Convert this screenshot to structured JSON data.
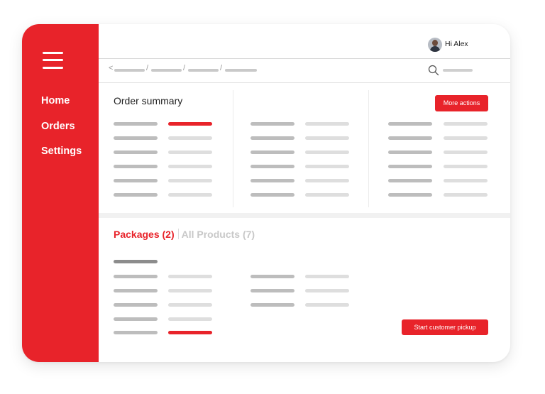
{
  "sidebar": {
    "items": [
      {
        "label": "Home"
      },
      {
        "label": "Orders"
      },
      {
        "label": "Settings"
      }
    ]
  },
  "header": {
    "greeting": "Hi Alex"
  },
  "breadcrumb": {
    "separators": [
      "<",
      "/",
      "/",
      "/"
    ]
  },
  "order_summary": {
    "title": "Order summary",
    "more_actions_label": "More actions"
  },
  "packages": {
    "tab_active": "Packages (2)",
    "tab_inactive": "All Products (7)",
    "start_pickup_label": "Start customer pickup"
  },
  "colors": {
    "accent": "#e8232a",
    "placeholder_dark": "#bdbdbd",
    "placeholder_light": "#dedede"
  }
}
